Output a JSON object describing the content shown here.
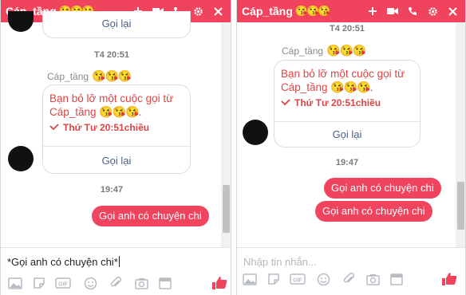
{
  "left_window": {
    "title": "Cáp_tầng",
    "title_emoji": "😘😘😘",
    "call_recall_top": "Gọi lại",
    "timestamp": "T4 20:51",
    "sender_name": "Cáp_tầng",
    "sender_emoji": "😘😘😘",
    "missed_call_text": "Bạn bỏ lỡ một cuộc gọi từ Cáp_tầng",
    "missed_call_emoji": "😘😘😘.",
    "call_time": "Thứ Tư 20:51chiều",
    "call_back": "Gọi lại",
    "time2": "19:47",
    "outgoing_message": "Gọi anh có chuyện chi",
    "composer_text": "*Gọi anh có chuyện chi*"
  },
  "right_window": {
    "title": "Cáp_tầng",
    "title_emoji": "😘😘😘",
    "timestamp": "T4 20:51",
    "sender_name": "Cáp_tầng",
    "sender_emoji": "😘😘😘",
    "missed_call_text": "Bạn bỏ lỡ một cuộc gọi từ Cáp_tầng",
    "missed_call_emoji": "😘😘😘.",
    "call_time": "Thứ Tư 20:51chiều",
    "call_back": "Gọi lại",
    "time2": "19:47",
    "outgoing_messages": [
      "Gọi anh có chuyện chi",
      "Gọi anh có chuyện chi"
    ],
    "composer_placeholder": "Nhập tin nhắn..."
  },
  "toolbar_icons": [
    "photo-icon",
    "sticker-icon",
    "gif-icon",
    "emoji-icon",
    "attach-icon",
    "camera-icon",
    "calendar-icon",
    "like-icon"
  ],
  "colors": {
    "accent": "#f0435d",
    "call_text": "#e04343",
    "link": "#4a5f88"
  }
}
